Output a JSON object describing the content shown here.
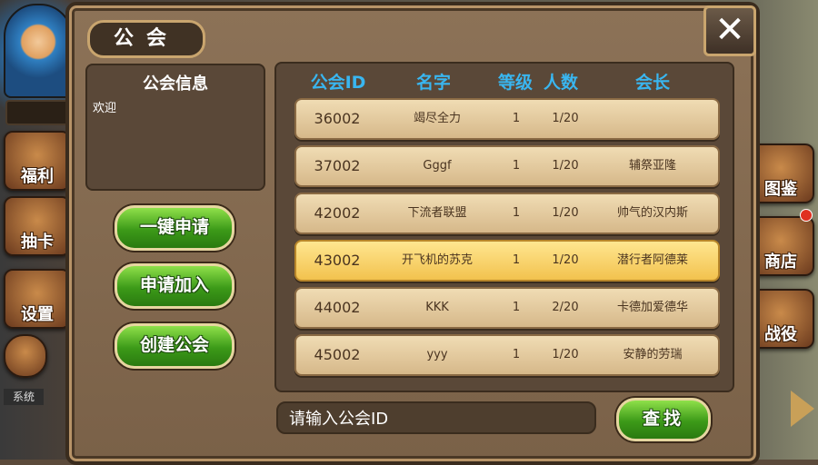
{
  "side_left": {
    "items": [
      {
        "label": "福利",
        "icon": "gift-icon"
      },
      {
        "label": "抽卡",
        "icon": "cards-icon"
      },
      {
        "label": "设置",
        "icon": "gear-icon"
      }
    ],
    "system_tab": "系统"
  },
  "side_right": {
    "items": [
      {
        "label": "图鉴",
        "icon": "book-icon"
      },
      {
        "label": "商店",
        "icon": "shop-icon"
      },
      {
        "label": "战役",
        "icon": "swords-icon"
      }
    ]
  },
  "dialog": {
    "title": "公会",
    "close": "✕",
    "info": {
      "title": "公会信息",
      "text": "欢迎"
    },
    "buttons": {
      "quick_apply": "一键申请",
      "apply_join": "申请加入",
      "create_guild": "创建公会"
    },
    "table": {
      "headers": {
        "id": "公会ID",
        "name": "名字",
        "level": "等级",
        "members": "人数",
        "leader": "会长"
      },
      "rows": [
        {
          "id": "36002",
          "name": "竭尽全力",
          "level": "1",
          "members": "1/20",
          "leader": ""
        },
        {
          "id": "37002",
          "name": "Gggf",
          "level": "1",
          "members": "1/20",
          "leader": "辅祭亚隆"
        },
        {
          "id": "42002",
          "name": "下流者联盟",
          "level": "1",
          "members": "1/20",
          "leader": "帅气的汉内斯"
        },
        {
          "id": "43002",
          "name": "开飞机的苏克",
          "level": "1",
          "members": "1/20",
          "leader": "潜行者阿德莱"
        },
        {
          "id": "44002",
          "name": "KKK",
          "level": "1",
          "members": "2/20",
          "leader": "卡德加爱德华"
        },
        {
          "id": "45002",
          "name": "yyy",
          "level": "1",
          "members": "1/20",
          "leader": "安静的劳瑞"
        }
      ],
      "selected_row": 3
    },
    "search": {
      "placeholder": "请输入公会ID",
      "button": "查找"
    }
  },
  "colors": {
    "header_text": "#39b6f0",
    "button_green": "#3c9a18",
    "selected_row": "#f2c24e"
  }
}
